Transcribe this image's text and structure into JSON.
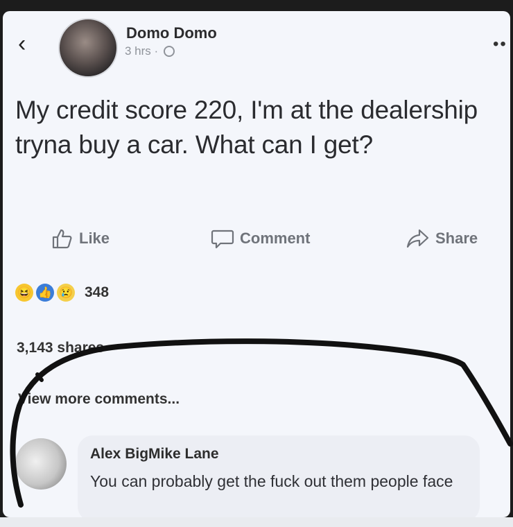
{
  "header": {
    "back_icon": "chevron-left-icon",
    "back_symbol": "‹",
    "name": "Domo Domo",
    "time": "3 hrs ·",
    "audience_icon": "globe-icon",
    "more_icon": "more-dots-icon",
    "more_symbol": "••"
  },
  "post": {
    "text": "My credit score 220, I'm at the dealership tryna buy a car. What can I get?"
  },
  "actions": {
    "like": {
      "label": "Like",
      "icon": "thumbs-up-icon"
    },
    "comment": {
      "label": "Comment",
      "icon": "comment-icon"
    },
    "share": {
      "label": "Share",
      "icon": "share-icon"
    }
  },
  "reactions": {
    "icons": [
      "haha-reaction-icon",
      "like-reaction-icon",
      "sad-reaction-icon"
    ],
    "haha_symbol": "😆",
    "like_symbol": "👍",
    "sad_symbol": "😢",
    "count": "348"
  },
  "shares": "3,143 shares",
  "view_more": "View more comments...",
  "comment": {
    "author": "Alex BigMike Lane",
    "text": "You can probably get the fuck out them people face"
  },
  "colors": {
    "card_bg": "#f4f6fb",
    "text_primary": "#2a2b2f",
    "muted": "#8f939a",
    "bubble_bg": "#eceef4",
    "scribble": "#111111"
  }
}
